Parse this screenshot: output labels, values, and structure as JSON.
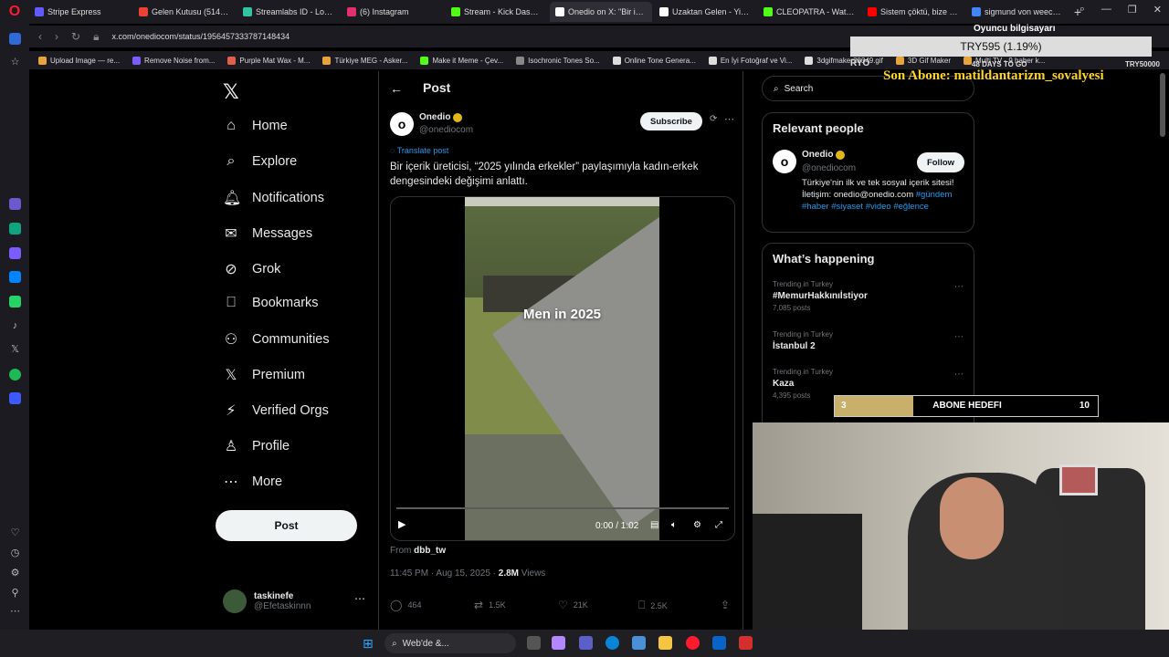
{
  "browser": {
    "tabs": [
      {
        "label": "Stripe Express",
        "color": "#635bff",
        "active": false
      },
      {
        "label": "Gelen Kutusu (514) - nor",
        "color": "#ea4335",
        "active": false
      },
      {
        "label": "Streamlabs ID - Log in",
        "color": "#31c3a2",
        "active": false
      },
      {
        "label": "(6) Instagram",
        "color": "#e1306c",
        "active": false
      },
      {
        "label": "Stream - Kick Dashboard",
        "color": "#53fc18",
        "active": false
      },
      {
        "label": "Onedio on X: \"Bir içerik ü",
        "color": "#ffffff",
        "active": true
      },
      {
        "label": "Uzaktan Gelen - Yine ge",
        "color": "#ffffff",
        "active": false
      },
      {
        "label": "CLEOPATRA - Watch the",
        "color": "#53fc18",
        "active": false
      },
      {
        "label": "Sistem çöktü, bize yenis",
        "color": "#ff0000",
        "active": false
      },
      {
        "label": "sigmund von weech - Go",
        "color": "#4285f4",
        "active": false
      }
    ],
    "url": "x.com/onediocom/status/1956457333787148434",
    "bookmarks": [
      {
        "label": "Upload Image — re...",
        "color": "#e8a33d"
      },
      {
        "label": "Remove Noise from...",
        "color": "#7b5cff"
      },
      {
        "label": "Purple Mat Wax - M...",
        "color": "#e0604b"
      },
      {
        "label": "Türkiye MEG - Asker...",
        "color": "#e8a33d"
      },
      {
        "label": "Make it Meme - Çev...",
        "color": "#53fc18"
      },
      {
        "label": "Isochronic Tones So...",
        "color": "#888888"
      },
      {
        "label": "Online Tone Genera...",
        "color": "#dddddd"
      },
      {
        "label": "En İyi Fotoğraf ve Vi...",
        "color": "#dddddd"
      },
      {
        "label": "3dgifmaker28349.gif",
        "color": "#dddddd"
      },
      {
        "label": "3D Gif Maker",
        "color": "#e8a33d"
      },
      {
        "label": "Multi TV - 9 haber k...",
        "color": "#e8a33d"
      }
    ]
  },
  "x": {
    "nav": [
      {
        "icon": "home-icon",
        "glyph": "⌂",
        "label": "Home"
      },
      {
        "icon": "explore-icon",
        "glyph": "⌕",
        "label": "Explore"
      },
      {
        "icon": "notifications-icon",
        "glyph": "🔔︎",
        "label": "Notifications"
      },
      {
        "icon": "messages-icon",
        "glyph": "✉",
        "label": "Messages"
      },
      {
        "icon": "grok-icon",
        "glyph": "⊘",
        "label": "Grok"
      },
      {
        "icon": "bookmarks-icon",
        "glyph": "⎕",
        "label": "Bookmarks"
      },
      {
        "icon": "communities-icon",
        "glyph": "⚇",
        "label": "Communities"
      },
      {
        "icon": "premium-icon",
        "glyph": "𝕏",
        "label": "Premium"
      },
      {
        "icon": "verified-orgs-icon",
        "glyph": "⚡",
        "label": "Verified Orgs"
      },
      {
        "icon": "profile-icon",
        "glyph": "♙",
        "label": "Profile"
      },
      {
        "icon": "more-icon",
        "glyph": "⋯",
        "label": "More"
      }
    ],
    "post_button": "Post",
    "account": {
      "name": "taskinefe",
      "handle": "@Efetaskinnn"
    },
    "post": {
      "header": "Post",
      "author_name": "Onedio",
      "author_handle": "@onediocom",
      "subscribe": "Subscribe",
      "translate": "Translate post",
      "text": "Bir içerik üreticisi, “2025 yılında erkekler” paylaşımıyla kadın-erkek dengesindeki değişimi anlattı.",
      "video_overlay": "Men in 2025",
      "video_time": "0:00 / 1:02",
      "from_prefix": "From",
      "from_source": "dbb_tw",
      "timestamp": "11:45 PM · Aug 15, 2025 · ",
      "views_count": "2.8M",
      "views_label": "Views",
      "replies": "464",
      "reposts": "1.5K",
      "likes": "21K",
      "bookmarks": "2.5K"
    },
    "right": {
      "search_placeholder": "Search",
      "relevant_title": "Relevant people",
      "person_name": "Onedio",
      "person_handle": "@onediocom",
      "follow": "Follow",
      "bio": "Türkiye'nin ilk ve tek sosyal içerik sitesi! İletişim: onedio@onedio.com",
      "bio_tags": "#gündem #haber #siyaset #video #eğlence",
      "happening_title": "What’s happening",
      "trends": [
        {
          "context": "Trending in Turkey",
          "name": "#MemurHakkınıİstiyor",
          "count": "7,085 posts"
        },
        {
          "context": "Trending in Turkey",
          "name": "İstanbul 2",
          "count": ""
        },
        {
          "context": "Trending in Turkey",
          "name": "Kaza",
          "count": "4,395 posts"
        }
      ]
    }
  },
  "overlay": {
    "top_label": "Oyuncu bilgisayarı",
    "price_box": "TRY595 (1.19%)",
    "left_tag": "RYO",
    "days": "48 DAYS TO GO",
    "target": "TRY50000",
    "last_sub": "Son Abone: matildantarizm_sovalyesi",
    "goal_current": "3",
    "goal_label": "ABONE HEDEFI",
    "goal_target": "10",
    "goal_fraction": 0.3
  },
  "taskbar": {
    "search": "Web'de &..."
  }
}
